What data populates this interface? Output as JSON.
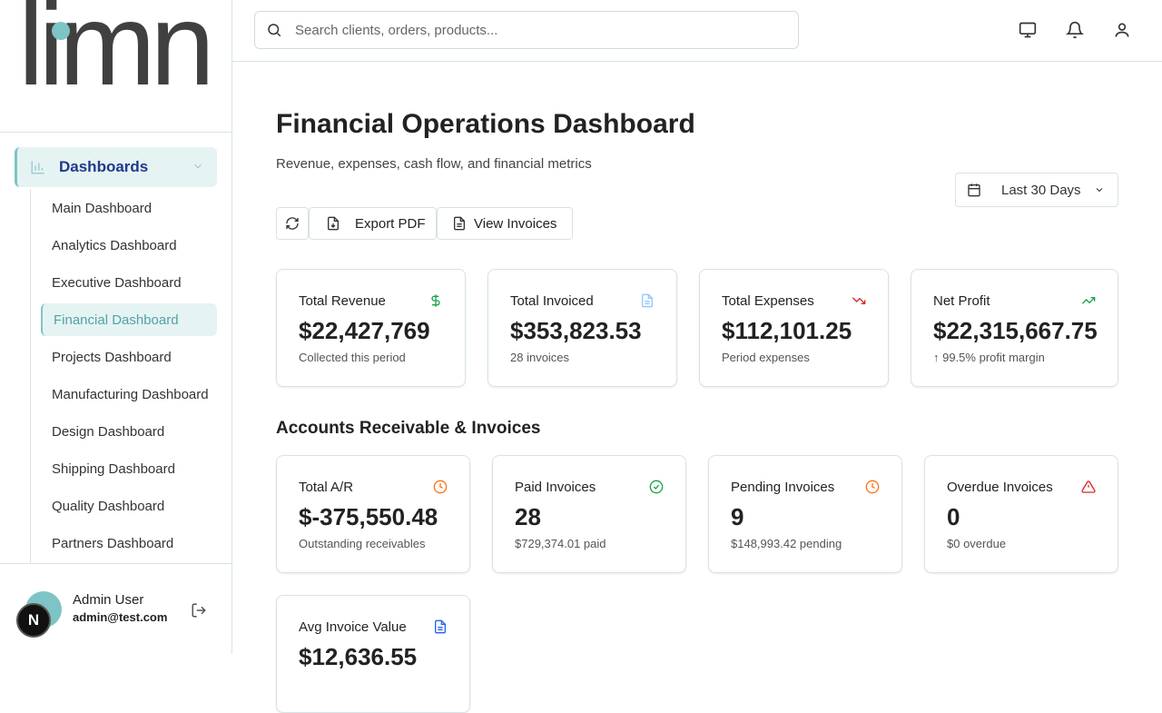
{
  "brand": {
    "logo_text": "limn"
  },
  "sidebar": {
    "group_label": "Dashboards",
    "items": [
      {
        "label": "Main Dashboard"
      },
      {
        "label": "Analytics Dashboard"
      },
      {
        "label": "Executive Dashboard"
      },
      {
        "label": "Financial Dashboard",
        "active": true
      },
      {
        "label": "Projects Dashboard"
      },
      {
        "label": "Manufacturing Dashboard"
      },
      {
        "label": "Design Dashboard"
      },
      {
        "label": "Shipping Dashboard"
      },
      {
        "label": "Quality Dashboard"
      },
      {
        "label": "Partners Dashboard"
      }
    ],
    "user": {
      "name": "Admin User",
      "email": "admin@test.com",
      "badge": "N"
    }
  },
  "topbar": {
    "search_placeholder": "Search clients, orders, products...",
    "icons": [
      "monitor-icon",
      "bell-icon",
      "user-icon"
    ]
  },
  "main": {
    "title": "Financial Operations Dashboard",
    "subtitle": "Revenue, expenses, cash flow, and financial metrics",
    "date_range": "Last 30 Days",
    "buttons": {
      "export": "Export PDF",
      "invoices": "View Invoices"
    },
    "kpis": [
      {
        "title": "Total Revenue",
        "value": "$22,427,769",
        "sub": "Collected this period",
        "icon": "dollar-icon",
        "color": "#16a34a"
      },
      {
        "title": "Total Invoiced",
        "value": "$353,823.53",
        "sub": "28 invoices",
        "icon": "document-icon",
        "color": "#93c5fd"
      },
      {
        "title": "Total Expenses",
        "value": "$112,101.25",
        "sub": "Period expenses",
        "icon": "trending-down-icon",
        "color": "#dc2626"
      },
      {
        "title": "Net Profit",
        "value": "$22,315,667.75",
        "sub": "↑ 99.5% profit margin",
        "icon": "trending-up-icon",
        "color": "#16a34a"
      }
    ],
    "section_title": "Accounts Receivable & Invoices",
    "ar_cards": [
      {
        "title": "Total A/R",
        "value": "$-375,550.48",
        "sub": "Outstanding receivables",
        "icon": "clock-icon",
        "color": "#f97316"
      },
      {
        "title": "Paid Invoices",
        "value": "28",
        "sub": "$729,374.01 paid",
        "icon": "check-circle-icon",
        "color": "#16a34a"
      },
      {
        "title": "Pending Invoices",
        "value": "9",
        "sub": "$148,993.42 pending",
        "icon": "clock-icon",
        "color": "#f97316"
      },
      {
        "title": "Overdue Invoices",
        "value": "0",
        "sub": "$0 overdue",
        "icon": "alert-triangle-icon",
        "color": "#dc2626"
      }
    ],
    "avg_card": {
      "title": "Avg Invoice Value",
      "value": "$12,636.55",
      "icon": "document-icon",
      "color": "#2563eb"
    }
  }
}
